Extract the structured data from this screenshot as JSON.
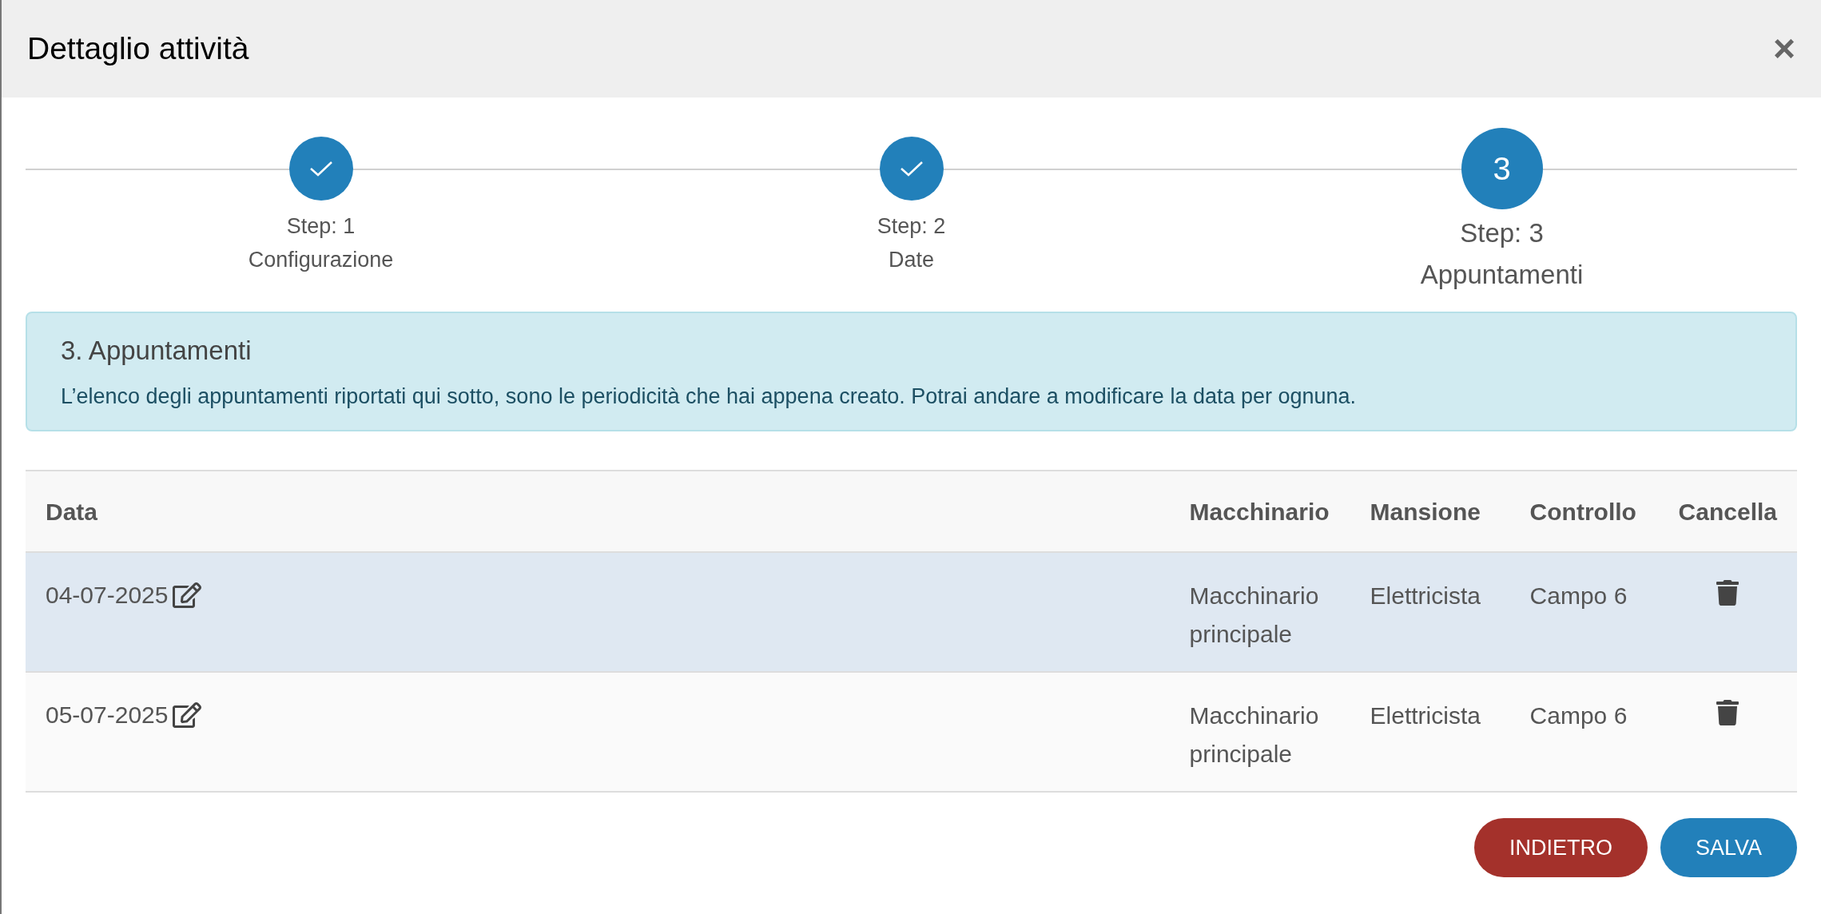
{
  "dialog": {
    "title": "Dettaglio attività",
    "close": "×"
  },
  "steps": [
    {
      "label": "Step: 1",
      "name": "Configurazione",
      "done": true,
      "selected": false
    },
    {
      "label": "Step: 2",
      "name": "Date",
      "done": true,
      "selected": false
    },
    {
      "number": "3",
      "label": "Step: 3",
      "name": "Appuntamenti",
      "done": false,
      "selected": true
    }
  ],
  "info": {
    "title": "3. Appuntamenti",
    "text": "L’elenco degli appuntamenti riportati qui sotto, sono le periodicità che hai appena creato. Potrai andare a modificare la data per ognuna."
  },
  "table": {
    "columns": [
      "Data",
      "Macchinario",
      "Mansione",
      "Controllo",
      "Cancella"
    ],
    "rows": [
      {
        "date": "04-07-2025",
        "machine": "Macchinario principale",
        "role": "Elettricista",
        "control": "Campo 6",
        "selected": true
      },
      {
        "date": "05-07-2025",
        "machine": "Macchinario principale",
        "role": "Elettricista",
        "control": "Campo 6",
        "selected": false
      }
    ]
  },
  "buttons": [
    {
      "label": "INDIETRO",
      "kind": "back"
    },
    {
      "label": "SALVA",
      "kind": "save"
    }
  ]
}
